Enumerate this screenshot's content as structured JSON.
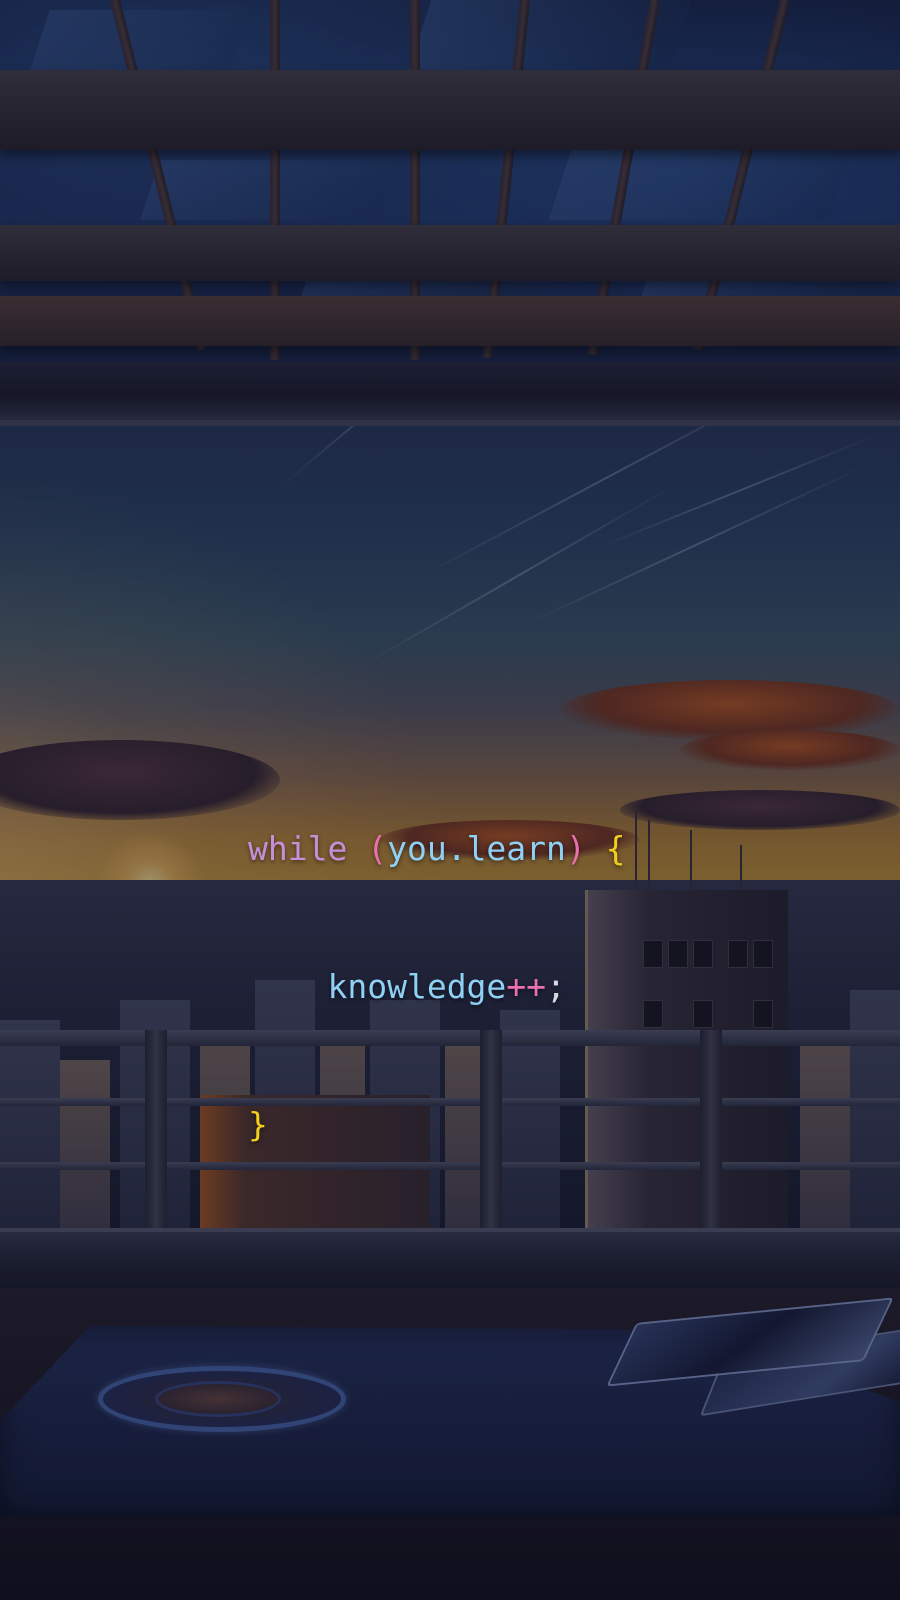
{
  "code": {
    "line1": {
      "keyword": "while",
      "open_paren": "(",
      "expression": "you.learn",
      "close_paren": ")",
      "open_brace": "{"
    },
    "line2": {
      "identifier": "knowledge",
      "operator": "++",
      "semicolon": ";"
    },
    "line3": {
      "close_brace": "}"
    }
  },
  "colors": {
    "keyword": "#c98ed8",
    "paren": "#ec6fb2",
    "identifier": "#8fd0f5",
    "brace": "#f2cf1c",
    "operator": "#ec6fb2",
    "punctuation": "#d8d8e2"
  }
}
